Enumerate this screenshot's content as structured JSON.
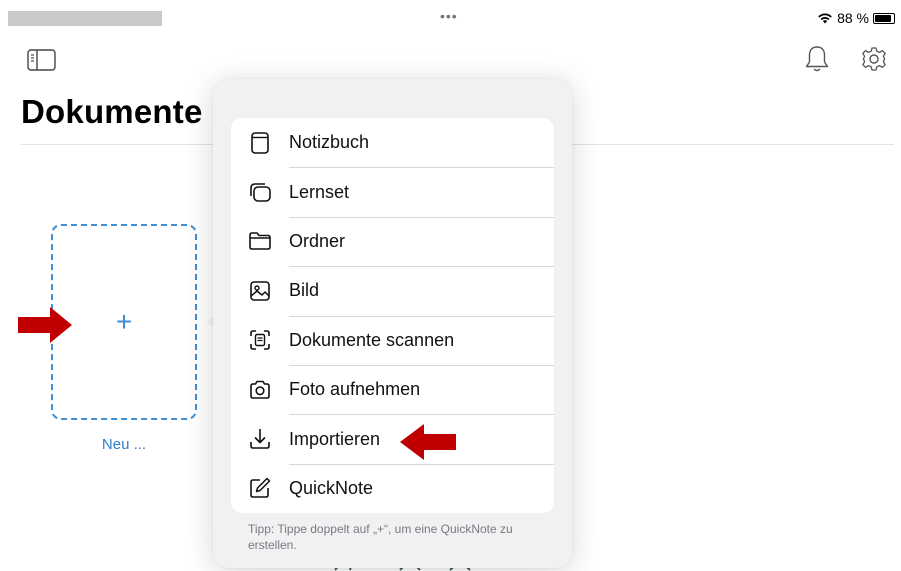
{
  "status_bar": {
    "dots": "•••",
    "battery_text": "88 %",
    "battery_level": 0.88
  },
  "toolbar": {
    "sidebar_icon": "sidebar-icon",
    "bell_icon": "bell-icon",
    "gear_icon": "gear-icon"
  },
  "page": {
    "title": "Dokumente"
  },
  "new_tile": {
    "plus": "+",
    "label": "Neu ..."
  },
  "menu": {
    "items": [
      {
        "label": "Notizbuch",
        "icon": "notebook-icon"
      },
      {
        "label": "Lernset",
        "icon": "flashcards-icon"
      },
      {
        "label": "Ordner",
        "icon": "folder-icon"
      },
      {
        "label": "Bild",
        "icon": "image-icon"
      },
      {
        "label": "Dokumente scannen",
        "icon": "scan-document-icon"
      },
      {
        "label": "Foto aufnehmen",
        "icon": "camera-icon"
      },
      {
        "label": "Importieren",
        "icon": "import-icon"
      },
      {
        "label": "QuickNote",
        "icon": "quicknote-icon"
      }
    ],
    "tip": "Tipp: Tippe doppelt auf „+“, um eine QuickNote zu erstellen."
  },
  "colors": {
    "accent": "#3f8fd8",
    "arrow": "#c00000",
    "popover_bg": "#f1f1f3"
  }
}
